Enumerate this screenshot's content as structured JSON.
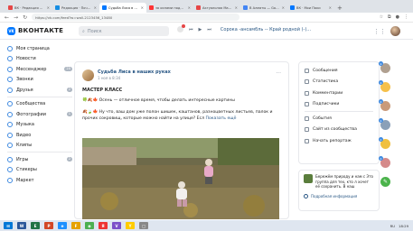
{
  "browser": {
    "tabs": [
      {
        "label": "ВК · Редакция — Будь",
        "fav": "#e64646",
        "active": false
      },
      {
        "label": "Редакция · Почта Mail.ru",
        "fav": "#168de2",
        "active": false
      },
      {
        "label": "Судьба Лиса в наших руках",
        "fav": "#0077ff",
        "active": true
      },
      {
        "label": "за окнами подмёт — Яндекс",
        "fav": "#f33",
        "active": false
      },
      {
        "label": "Актуальная Марина К.",
        "fav": "#e64646",
        "active": false
      },
      {
        "label": "В Алматы — Google",
        "fav": "#4285f4",
        "active": false
      },
      {
        "label": "ВК · Мои Паки",
        "fav": "#0077ff",
        "active": false
      }
    ],
    "url": "https://vk.com/feed?w=wall-2123456_13480",
    "new_tab": "+"
  },
  "header": {
    "logo_text": "VK",
    "brand": "ВКОНТАКТЕ",
    "search_placeholder": "Поиск",
    "now_playing": "Сорока -ансамбль -- Край родной (-)..."
  },
  "sidebar": {
    "items": [
      {
        "label": "Моя страница",
        "count": ""
      },
      {
        "label": "Новости",
        "count": ""
      },
      {
        "label": "Мессенджер",
        "count": "20"
      },
      {
        "label": "Звонки",
        "count": ""
      },
      {
        "label": "Друзья",
        "count": "2"
      },
      {
        "label": "Сообщества",
        "count": ""
      },
      {
        "label": "Фотографии",
        "count": "1"
      },
      {
        "label": "Музыка",
        "count": ""
      },
      {
        "label": "Видео",
        "count": ""
      },
      {
        "label": "Клипы",
        "count": ""
      },
      {
        "label": "Игры",
        "count": "2"
      },
      {
        "label": "Стикеры",
        "count": ""
      },
      {
        "label": "Маркет",
        "count": ""
      }
    ]
  },
  "post": {
    "group": "Судьба Лиса в наших руках",
    "date": "1 ноя в 8:34",
    "title": "МАСТЕР КЛАСС",
    "line1": "🍀🍂🍁 Осень — отличное время, чтобы делать интересные картины",
    "text": "🍂🍃🍁 Ну что, ваш дом уже полон шишек, каштанов, разноцветных листьев, палок и прочих сокровищ, которые можно найти на улице? Есл",
    "show_more": "Показать ещё"
  },
  "right_menu": {
    "items": [
      "Сообщения",
      "Статистика",
      "Комментарии",
      "Подписчики",
      "События",
      "Сайт из сообщества",
      "Начать репортаж"
    ]
  },
  "promo": {
    "text": "Бережём природу и нам с  Это группа для тех, кто л  хочет её сохранить. В наш",
    "footer": "Подробная информация"
  },
  "chat_rail": [
    {
      "color": "#b0a090",
      "badge": "9"
    },
    {
      "color": "#f5c04a",
      "badge": "9"
    },
    {
      "color": "#c99a7a",
      "badge": "9"
    },
    {
      "color": "#8aa0b8",
      "badge": "9"
    },
    {
      "color": "#f0c040",
      "badge": "9"
    },
    {
      "color": "#d58a8a",
      "badge": "9"
    }
  ],
  "compose_icon": "✎",
  "taskbar": {
    "apps": [
      {
        "label": "W",
        "color": "#2b579a"
      },
      {
        "label": "E",
        "color": "#217346"
      },
      {
        "label": "P",
        "color": "#d24726"
      },
      {
        "label": "e",
        "color": "#1e90ff"
      },
      {
        "label": "F",
        "color": "#e6a100"
      },
      {
        "label": "◉",
        "color": "#4caf50"
      },
      {
        "label": "Я",
        "color": "#e33"
      },
      {
        "label": "V",
        "color": "#7b4fc9"
      },
      {
        "label": "Y",
        "color": "#ffcc00"
      },
      {
        "label": "□",
        "color": "#888"
      }
    ],
    "lang": "RU",
    "time": "18:29"
  }
}
